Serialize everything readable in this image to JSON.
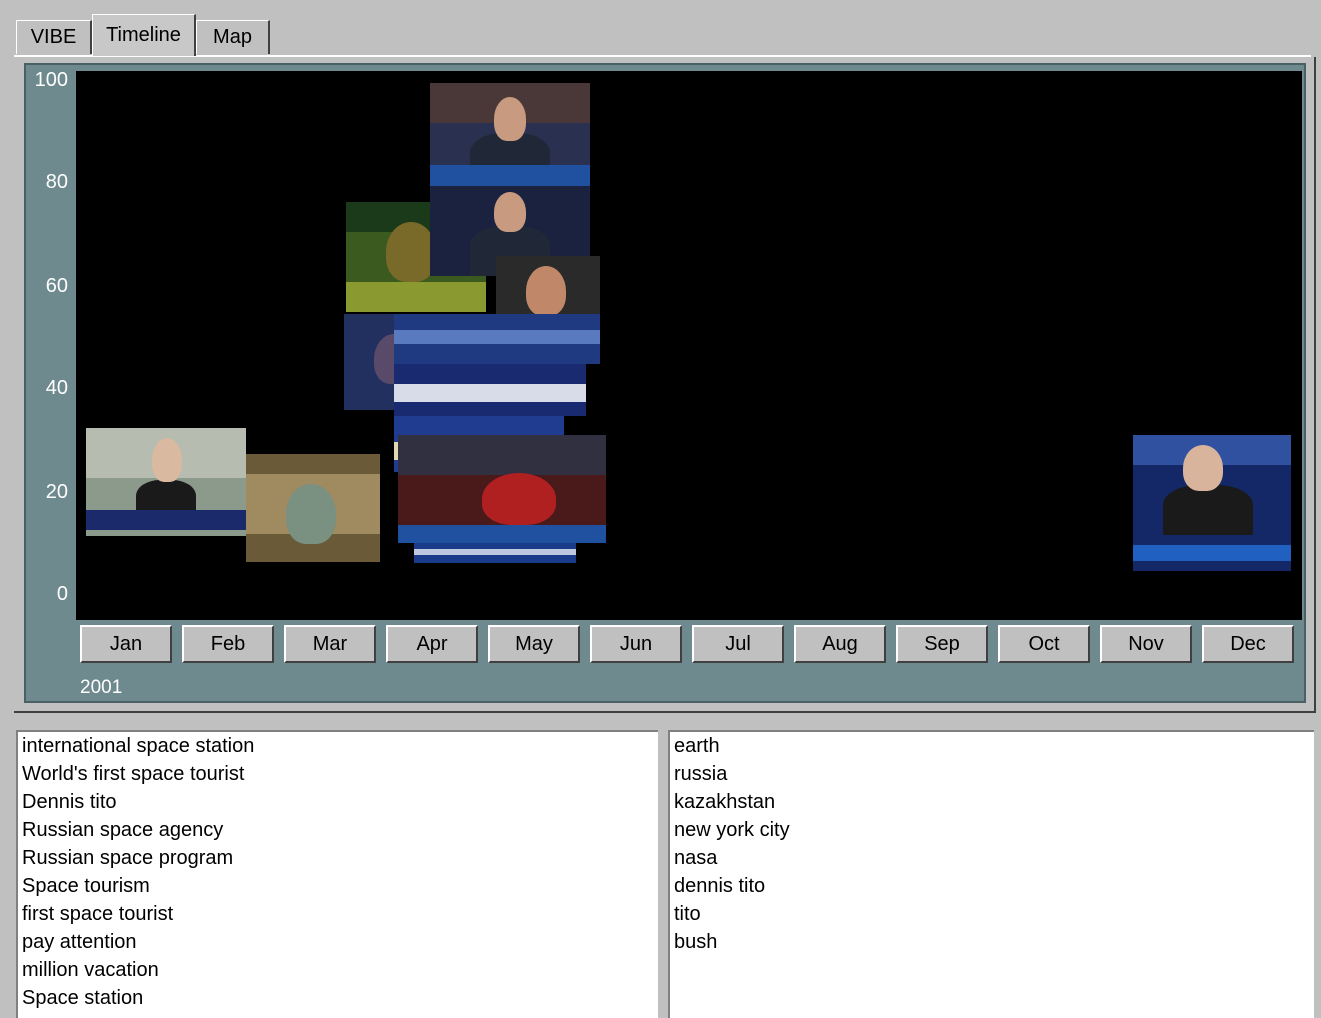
{
  "tabs": [
    {
      "label": "VIBE",
      "active": false
    },
    {
      "label": "Timeline",
      "active": true
    },
    {
      "label": "Map",
      "active": false
    }
  ],
  "timeline": {
    "y_ticks": [
      "100",
      "80",
      "60",
      "40",
      "20",
      "0"
    ],
    "months": [
      "Jan",
      "Feb",
      "Mar",
      "Apr",
      "May",
      "Jun",
      "Jul",
      "Aug",
      "Sep",
      "Oct",
      "Nov",
      "Dec"
    ],
    "year": "2001",
    "background_color": "#000000",
    "frame_color": "#6e8a8e"
  },
  "keywords_list": [
    "international space station",
    "World's first space tourist",
    "Dennis tito",
    "Russian space agency",
    "Russian space program",
    "Space tourism",
    "first space tourist",
    "pay attention",
    "million vacation",
    "Space station"
  ],
  "entities_list": [
    "earth",
    "russia",
    "kazakhstan",
    "new york city",
    "nasa",
    "dennis tito",
    "tito",
    "bush"
  ]
}
